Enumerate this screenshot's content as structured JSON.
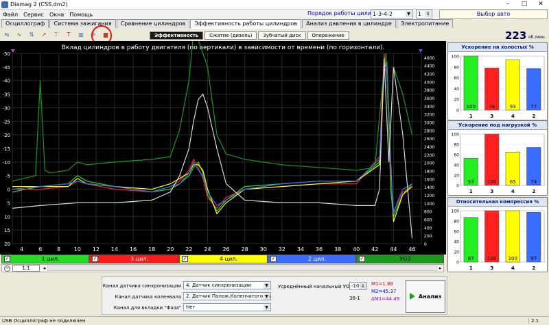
{
  "window": {
    "title": "Diamag 2 (CSS.dm2)",
    "minimize": "–",
    "maximize": "□",
    "close": "✕"
  },
  "menu": [
    "Файл",
    "Сервис",
    "Окна",
    "Помощь"
  ],
  "cylinder_order": {
    "label": "Порядок работы цилиндров",
    "value": "1-3-4-2",
    "spin": "1"
  },
  "auto_button": "Выбор авто",
  "tabs": [
    "Осциллограф",
    "Система зажигания",
    "Сравнение цилиндров",
    "Эффективность работы цилиндров",
    "Анализ давления в цилиндре",
    "Электропитание"
  ],
  "toolbar_icons": [
    "sync-icon",
    "signal-icon",
    "sort-icon",
    "chart-icon",
    "filter-icon",
    "text-marker-icon",
    "bars-icon",
    "compare-icon",
    "chart-bars-icon"
  ],
  "toolbar_glyphs": [
    "⇆",
    "∿",
    "⇅",
    "↗",
    "⊤",
    "T",
    "▥",
    "✣",
    "▆"
  ],
  "subtabs": [
    "Эффективность",
    "Сжатие (дизель)",
    "Зубчатый диск",
    "Опережение"
  ],
  "rpm": {
    "value": "223",
    "unit": "об./мин."
  },
  "chart_data": {
    "type": "line",
    "title": "Вклад цилиндров в работу двигателя (по вертикали) в зависимости от времени (по горизонтали).",
    "x_ticks": [
      4,
      6,
      8,
      10,
      12,
      14,
      16,
      18,
      20,
      22,
      24,
      26,
      28,
      30,
      32,
      34,
      36,
      38,
      40,
      42,
      44,
      46
    ],
    "y_left_ticks": [
      -50,
      -45,
      -40,
      -35,
      -30,
      -25,
      -20,
      -15,
      -10,
      -5,
      0,
      5,
      10,
      15,
      20
    ],
    "y_right_ticks": [
      0,
      200,
      400,
      600,
      800,
      1000,
      1200,
      1400,
      1600,
      1800,
      2000,
      2200,
      2400,
      2600,
      2800,
      3000,
      3200,
      3400,
      3600,
      3800,
      4000,
      4200,
      4400,
      4600
    ],
    "xlim": [
      3,
      47
    ],
    "ylim_left": [
      -50,
      20
    ],
    "ylim_right": [
      0,
      4700
    ],
    "background": "#000000",
    "grid": true,
    "series": [
      {
        "name": "1 цил.",
        "color": "#22dd22",
        "x": [
          3,
          6,
          9,
          10,
          11,
          14,
          18,
          20,
          21,
          22,
          22.5,
          23,
          23.5,
          24,
          25,
          26,
          28,
          32,
          36,
          40,
          42.5,
          43,
          43.3,
          43.7,
          44,
          44.5,
          45,
          46
        ],
        "y": [
          1,
          -1,
          -2,
          -5,
          -3,
          -1,
          1,
          0,
          -2,
          -5,
          -8,
          -10,
          -6,
          2,
          8,
          4,
          -1,
          -2,
          -3,
          -3,
          -10,
          -48,
          -45,
          0,
          10,
          6,
          2,
          -2
        ]
      },
      {
        "name": "3 цил.",
        "color": "#ff2020",
        "x": [
          3,
          6,
          9,
          10,
          11,
          14,
          18,
          20,
          21,
          22,
          22.5,
          23,
          23.5,
          24,
          25,
          26,
          28,
          32,
          36,
          40,
          42.5,
          43,
          43.3,
          43.7,
          44,
          44.5,
          45,
          46
        ],
        "y": [
          0,
          0,
          -1,
          -3,
          -2,
          0,
          1,
          -1,
          -3,
          -7,
          -11,
          -8,
          -4,
          3,
          7,
          3,
          0,
          -1,
          -2,
          -2,
          -12,
          -50,
          -40,
          -5,
          8,
          5,
          1,
          -1
        ]
      },
      {
        "name": "4 цил.",
        "color": "#ffff00",
        "x": [
          3,
          6,
          9,
          10,
          11,
          14,
          18,
          20,
          21,
          22,
          22.5,
          23,
          23.5,
          24,
          25,
          26,
          28,
          32,
          36,
          40,
          42.5,
          43,
          43.3,
          43.7,
          44,
          44.5,
          45,
          46
        ],
        "y": [
          -1,
          -1,
          -1,
          -4,
          -2,
          -1,
          0,
          -2,
          -4,
          -6,
          -9,
          -9,
          -7,
          0,
          9,
          5,
          0,
          -1,
          -2,
          -3,
          -9,
          -45,
          -46,
          -10,
          12,
          7,
          2,
          -1
        ]
      },
      {
        "name": "2 цил.",
        "color": "#3070ff",
        "x": [
          3,
          6,
          9,
          10,
          11,
          14,
          18,
          20,
          21,
          22,
          22.5,
          23,
          23.5,
          24,
          25,
          26,
          28,
          32,
          36,
          40,
          42.5,
          43,
          43.3,
          43.7,
          44,
          44.5,
          45,
          46
        ],
        "y": [
          0,
          -1,
          -2,
          -3,
          -2,
          -1,
          1,
          -1,
          -2,
          -6,
          -10,
          -7,
          -5,
          1,
          6,
          4,
          0,
          -2,
          -3,
          -3,
          -11,
          -42,
          -47,
          -8,
          9,
          4,
          0,
          -2
        ]
      },
      {
        "name": "УОЗ",
        "color": "#1a9a1a",
        "x": [
          3,
          5.5,
          6,
          6.5,
          7,
          9,
          10,
          11,
          14,
          18,
          20,
          21,
          22,
          22.5,
          23,
          24,
          25,
          26,
          28,
          32,
          36,
          40,
          42,
          42.8,
          43.2,
          43.6,
          44,
          45,
          46
        ],
        "y": [
          -3,
          -5,
          -40,
          -7,
          -6,
          -7,
          -10,
          -9,
          -10,
          -11,
          -12,
          -22,
          -40,
          -58,
          -55,
          -45,
          -20,
          -13,
          -11,
          -9,
          -8,
          -7,
          -8,
          -38,
          -50,
          -15,
          -45,
          -35,
          -20
        ]
      },
      {
        "name": "rpm",
        "color": "#d8d8d8",
        "x": [
          3,
          6,
          10,
          14,
          18,
          20,
          21,
          22,
          22.5,
          23,
          23.5,
          24,
          25,
          26,
          28,
          32,
          36,
          40,
          42,
          42.5,
          43,
          43.5,
          44,
          45,
          46
        ],
        "y": [
          7,
          6,
          5,
          5,
          4,
          1,
          -5,
          -15,
          -25,
          -33,
          -35,
          -30,
          -15,
          -2,
          4,
          5,
          5,
          6,
          6,
          0,
          -48,
          -10,
          -45,
          -20,
          18
        ]
      }
    ]
  },
  "legend": [
    {
      "label": "1 цил.",
      "color": "#22dd22",
      "text_color": "#000000",
      "checked": "✓"
    },
    {
      "label": "3 цил.",
      "color": "#ff1a1a",
      "text_color": "#ffffff",
      "checked": "✓"
    },
    {
      "label": "4 цил.",
      "color": "#ffff00",
      "text_color": "#000000",
      "checked": "✓"
    },
    {
      "label": "2 цил.",
      "color": "#3a6cff",
      "text_color": "#ffffff",
      "checked": "✓"
    },
    {
      "label": "УОЗ",
      "color": "#1a9a1a",
      "text_color": "#000000",
      "checked": "✓"
    }
  ],
  "zoom": {
    "label": "1:1",
    "minus": "−"
  },
  "channels": {
    "sync_label": "Канал датчика синхронизации",
    "sync_value": "4. Датчик синхронизации",
    "crank_label": "Канал датчика коленвала",
    "crank_value": "2. Датчик Полож.Коленчатого Вал",
    "phase_label": "Канал для вкладки \"Фаза\"",
    "phase_value": "Нет"
  },
  "uoz": {
    "label": "Усреднённый начальный УОЗ",
    "value": "-10",
    "code": "36-1"
  },
  "markers": {
    "m1": "M1=1.88",
    "m2": "M2=45.37",
    "dm1": "ΔM1=44.49"
  },
  "analyze_button": "Анализ",
  "status": {
    "text": "USB Осциллограф не подключен",
    "version": "2.1"
  },
  "bar_panels": [
    {
      "title": "Ускорение на холостых %",
      "cylinders": [
        "1",
        "3",
        "4",
        "2"
      ],
      "values": [
        100,
        78,
        93,
        77
      ]
    },
    {
      "title": "Ускорение под нагрузкой %",
      "cylinders": [
        "1",
        "3",
        "4",
        "2"
      ],
      "values": [
        53,
        100,
        65,
        74
      ]
    },
    {
      "title": "Относительная компрессия %",
      "cylinders": [
        "1",
        "3",
        "4",
        "2"
      ],
      "values": [
        87,
        100,
        100,
        97
      ]
    }
  ],
  "bar_axis_ticks": [
    0,
    20,
    40,
    60,
    80,
    100
  ],
  "bar_colors": [
    "#22ee22",
    "#ff2020",
    "#ffff00",
    "#3a6cff"
  ]
}
